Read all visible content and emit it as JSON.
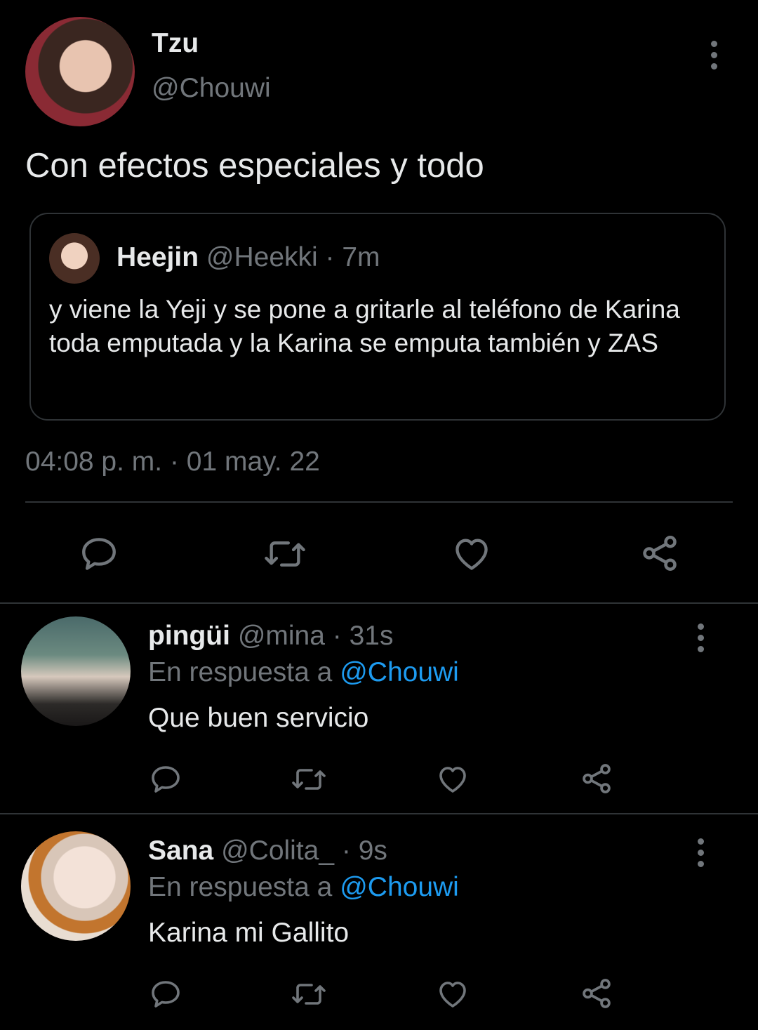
{
  "main_tweet": {
    "display_name": "Tzu",
    "handle": "@Chouwi",
    "text": "Con efectos especiales y todo",
    "timestamp": "04:08 p. m. · 01 may. 22",
    "quoted": {
      "display_name": "Heejin",
      "handle": "@Heekki",
      "time": "· 7m",
      "text": "y viene la Yeji y se pone a gritarle al teléfono de Karina toda emputada y la Karina se emputa también y ZAS"
    }
  },
  "replies": [
    {
      "display_name": "pingüi",
      "handle": "@mina",
      "time": "· 31s",
      "reply_prefix": "En respuesta a",
      "reply_to": "@Chouwi",
      "text": "Que buen servicio"
    },
    {
      "display_name": "Sana",
      "handle": "@Colita_",
      "time": "· 9s",
      "reply_prefix": "En respuesta a",
      "reply_to": "@Chouwi",
      "text": "Karina mi Gallito"
    }
  ],
  "icons": [
    "reply-icon",
    "retweet-icon",
    "like-icon",
    "share-icon",
    "more-icon"
  ],
  "colors": {
    "background": "#000000",
    "text": "#e7e9ea",
    "muted": "#71767b",
    "link": "#1d9bf0",
    "border": "#2f3336"
  }
}
